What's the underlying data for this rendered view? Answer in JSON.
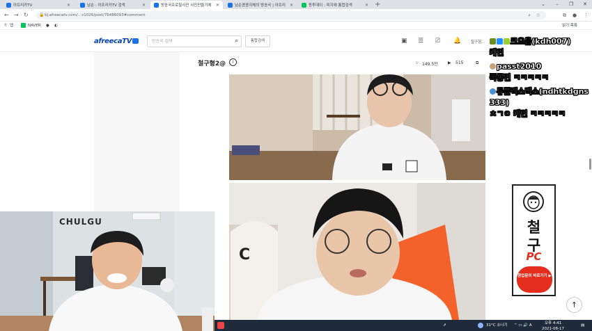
{
  "browser": {
    "tabs": [
      {
        "title": "아프리카TV",
        "color": "#1a73e8",
        "active": false
      },
      {
        "title": "남순 : 아프리카TV 검색",
        "color": "#1a73e8",
        "active": false
      },
      {
        "title": "방송국프로필사진 사진만들기에",
        "color": "#1a73e8",
        "active": true
      },
      {
        "title": "남순콩콩자체의 방송국 | 아프리",
        "color": "#1a73e8",
        "active": false
      },
      {
        "title": "동투데이 : 피지애 통합검색",
        "color": "#03c75a",
        "active": false
      }
    ],
    "new_tab": "+",
    "window_controls": [
      "⌄",
      "–",
      "❐",
      "✕"
    ],
    "url": "bj.afreecatv.com/...v1026/post/76486093#comment",
    "bookmarks": [
      {
        "label": "앱"
      },
      {
        "label": "NAVER"
      }
    ],
    "reading_list": "읽기 목록"
  },
  "site": {
    "logo": "afreecaTV",
    "search_placeholder": "방송국 검색",
    "total_search": "통합검색",
    "user_label": "철구형..."
  },
  "post": {
    "title": "철구형2@",
    "info_icon": "i",
    "likes": "149.5만",
    "views": "515"
  },
  "webcam": {
    "sign": "CHULGU"
  },
  "chat": [
    {
      "nick": "크으읍(kdh007)",
      "message": "케인",
      "badges": [
        "#6b8e23",
        "#1e90ff",
        "#9acd32"
      ]
    },
    {
      "nick": "passt2010",
      "message": "쪽통민 ㅋㅋㅋㅋㅋ",
      "badges": []
    },
    {
      "nick": "듀플렉스맥스(ndhtkdgns333)",
      "message": "ㅊㄱㅇ 케인 ㅋㅋㅋㅋㅋ",
      "badges": [
        "#4a90d9"
      ]
    }
  ],
  "banner": {
    "title_line1": "철",
    "title_line2": "구",
    "title_line3": "PC",
    "cta": "창업문의 바로가기 ▶"
  },
  "scroll_top": "↑",
  "taskbar": {
    "weather": "31°C 소나기",
    "time": "오후 4:41",
    "date": "2021-08-17"
  },
  "colors": {
    "accent": "#0545b1",
    "banner_red": "#e52d1e",
    "taskbar": "#1f2a3a"
  }
}
